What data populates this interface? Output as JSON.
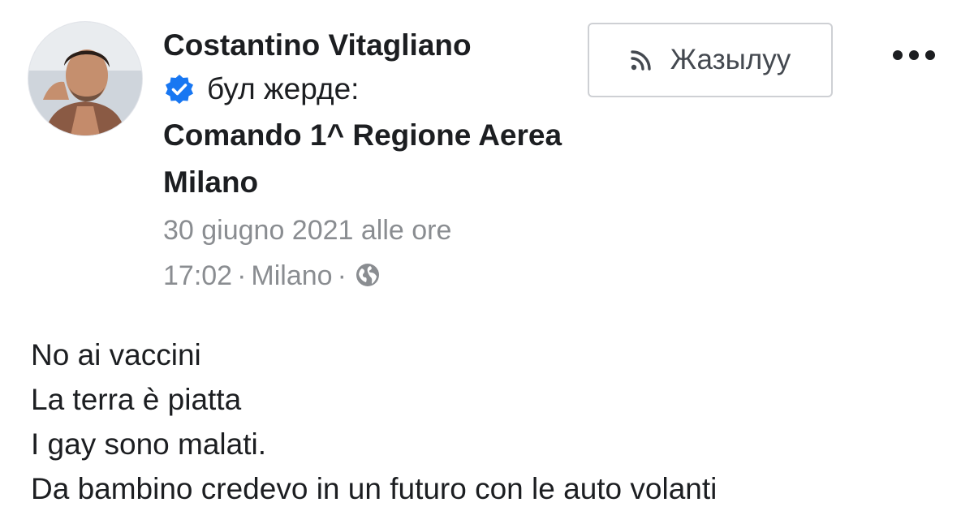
{
  "post": {
    "author": "Costantino Vitagliano",
    "checkin_text": "бул жерде:",
    "place": "Comando 1^ Regione Aerea Milano",
    "date_line": "30 giugno 2021 alle ore",
    "time": "17:02",
    "separator": "·",
    "location": "Milano",
    "privacy_icon": "globe-icon",
    "verified_icon": "verified-badge-icon",
    "body_lines": [
      "No ai vaccini",
      "La terra è piatta",
      "I gay sono malati.",
      "Da bambino credevo in un futuro con le auto volanti"
    ]
  },
  "actions": {
    "follow_label": "Жазылуу",
    "follow_icon": "rss-icon",
    "more_icon": "more-dots-icon"
  },
  "colors": {
    "verified_blue": "#1877f2",
    "text_primary": "#1c1e21",
    "text_secondary": "#8a8d91",
    "button_border": "#ced0d4"
  }
}
